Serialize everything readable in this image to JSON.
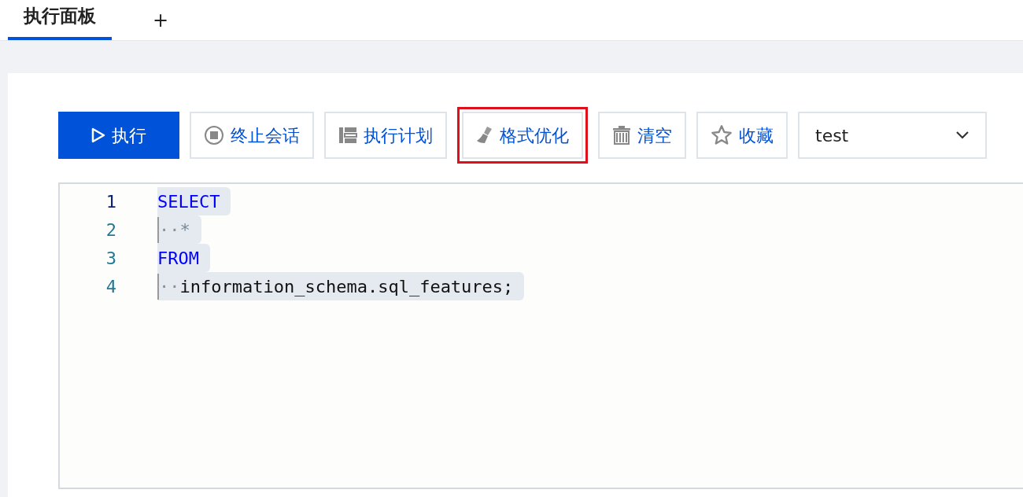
{
  "tabs": [
    {
      "label": "执行面板",
      "selected": true
    }
  ],
  "add_tab": "+",
  "toolbar": {
    "buttons": [
      {
        "label": "执行",
        "kind": "primary",
        "highlighted": false
      },
      {
        "label": "终止会话",
        "kind": "default",
        "highlighted": false
      },
      {
        "label": "执行计划",
        "kind": "default",
        "highlighted": false
      },
      {
        "label": "格式优化",
        "kind": "default",
        "highlighted": true
      },
      {
        "label": "清空",
        "kind": "default",
        "highlighted": false
      },
      {
        "label": "收藏",
        "kind": "default",
        "highlighted": false
      }
    ],
    "database_select": {
      "value": "test"
    }
  },
  "editor": {
    "lines": [
      {
        "number": "1",
        "active": true,
        "tokens": [
          {
            "kind": "keyword",
            "text": "SELECT"
          }
        ]
      },
      {
        "number": "2",
        "active": false,
        "tokens": [
          {
            "kind": "indent",
            "text": "··"
          },
          {
            "kind": "operator",
            "text": "*"
          }
        ]
      },
      {
        "number": "3",
        "active": false,
        "tokens": [
          {
            "kind": "keyword",
            "text": "FROM"
          }
        ]
      },
      {
        "number": "4",
        "active": false,
        "tokens": [
          {
            "kind": "indent",
            "text": "··"
          },
          {
            "kind": "plain",
            "text": "information_schema.sql_features;"
          }
        ]
      }
    ]
  }
}
